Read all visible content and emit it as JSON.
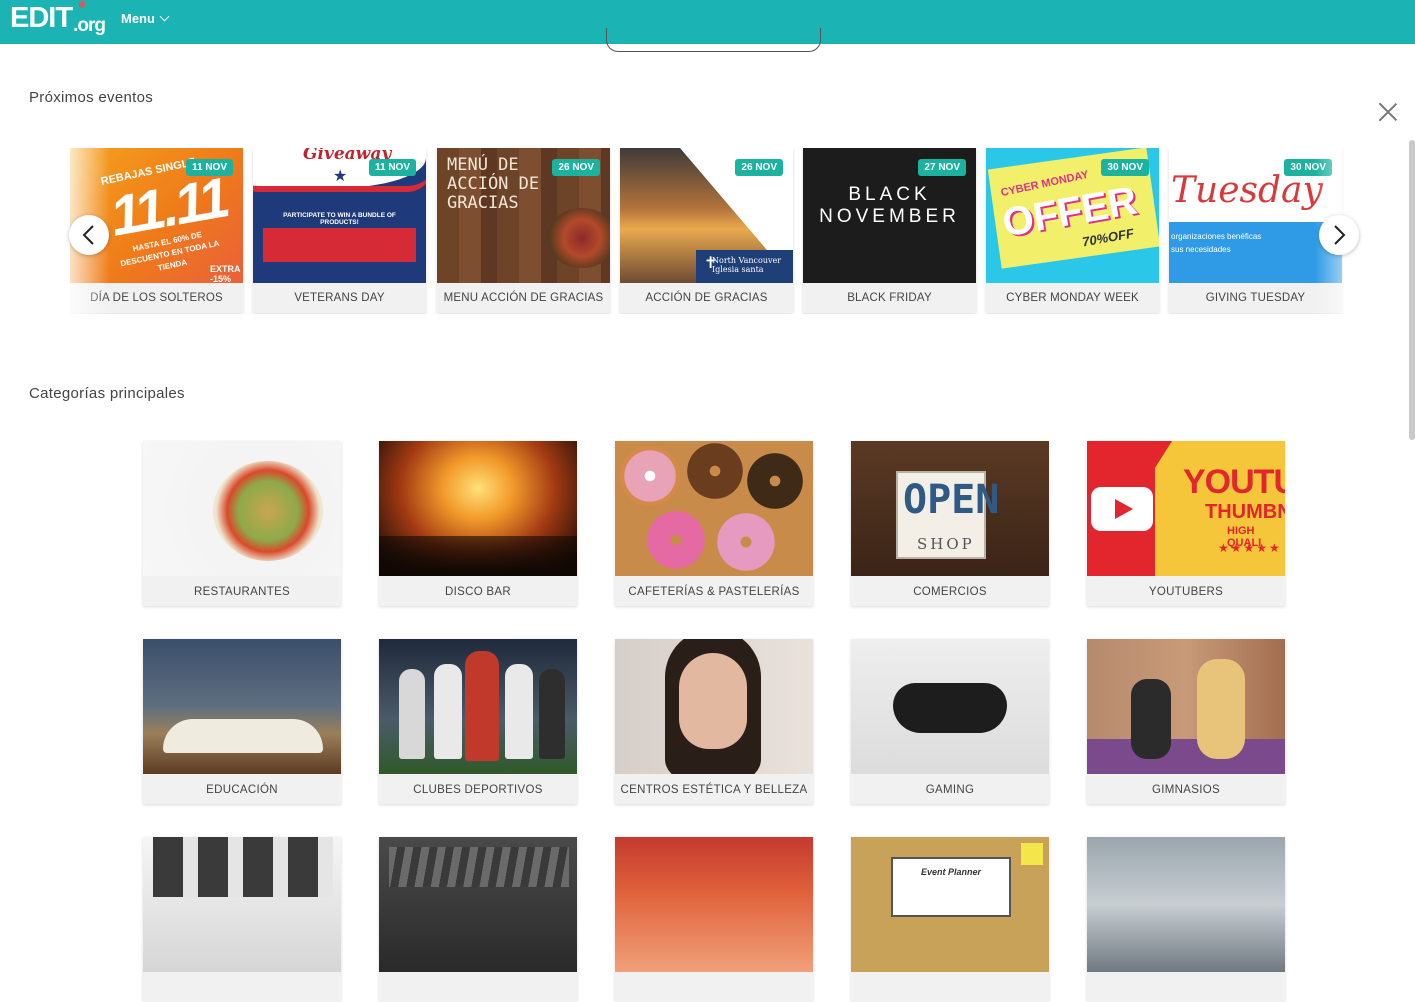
{
  "header": {
    "logo_main": "EDIT",
    "logo_suffix": ".org",
    "menu_label": "Menu"
  },
  "events": {
    "title": "Próximos eventos",
    "items": [
      {
        "label": "DÍA DE LOS SOLTEROS",
        "date": "11 NOV",
        "thumb_text": "11.11",
        "thumb_sub": "REBAJAS SINGLE",
        "thumb_extra": "HASTA EL 60% DE DESCUENTO EN TODA LA TIENDA",
        "thumb_extra2": "EXTRA -15%"
      },
      {
        "label": "VETERANS DAY",
        "date": "11 NOV",
        "thumb_text": "Giveaway",
        "thumb_sub": "PARTICIPATE TO WIN A BUNDLE OF PRODUCTS!"
      },
      {
        "label": "MENU ACCIÓN DE GRACIAS",
        "date": "26 NOV",
        "thumb_text": "MENÚ DE ACCIÓN DE GRACIAS"
      },
      {
        "label": "ACCIÓN DE GRACIAS",
        "date": "26 NOV",
        "thumb_text": "North Vancouver Iglesia santa"
      },
      {
        "label": "BLACK FRIDAY",
        "date": "27 NOV",
        "thumb_text": "BLACK NOVEMBER"
      },
      {
        "label": "CYBER MONDAY WEEK",
        "date": "30 NOV",
        "thumb_text": "OFFER",
        "thumb_sub": "CYBER MONDAY",
        "thumb_extra": "70%OFF"
      },
      {
        "label": "GIVING TUESDAY",
        "date": "30 NOV",
        "thumb_text": "Tuesday",
        "thumb_sub": "organizaciones benéficas",
        "thumb_extra": "sus necesidades"
      }
    ]
  },
  "categories": {
    "title": "Categorías principales",
    "items": [
      {
        "label": "RESTAURANTES"
      },
      {
        "label": "DISCO BAR"
      },
      {
        "label": "CAFETERÍAS & PASTELERÍAS"
      },
      {
        "label": "COMERCIOS",
        "thumb_text": "OPEN",
        "thumb_sub": "SHOP"
      },
      {
        "label": "YOUTUBERS",
        "thumb_text": "YOUTUB",
        "thumb_sub": "THUMBNA",
        "thumb_extra": "HIGH QUALI"
      },
      {
        "label": "EDUCACIÓN"
      },
      {
        "label": "CLUBES DEPORTIVOS"
      },
      {
        "label": "CENTROS ESTÉTICA Y BELLEZA"
      },
      {
        "label": "GAMING"
      },
      {
        "label": "GIMNASIOS"
      },
      {
        "label": ""
      },
      {
        "label": ""
      },
      {
        "label": ""
      },
      {
        "label": "",
        "thumb_text": "Event Planner"
      },
      {
        "label": ""
      }
    ]
  },
  "colors": {
    "brand": "#1bb3b3",
    "badge": "#1bb3a0"
  }
}
